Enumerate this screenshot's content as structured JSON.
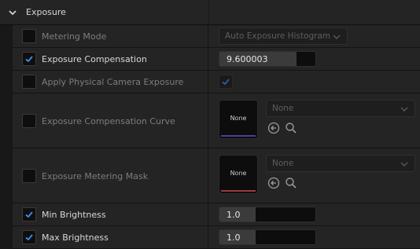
{
  "section": {
    "title": "Exposure",
    "icon": "chevron-down-icon"
  },
  "rows": [
    {
      "label": "Metering Mode",
      "checked": false,
      "enabled": false,
      "value": "Auto Exposure Histogram"
    },
    {
      "label": "Exposure Compensation",
      "checked": true,
      "enabled": true,
      "value": "9.600003",
      "fill_fraction": 0.8
    },
    {
      "label": "Apply Physical Camera Exposure",
      "checked": false,
      "enabled": false,
      "value_checked": true
    },
    {
      "label": "Exposure Compensation Curve",
      "checked": false,
      "enabled": false,
      "thumb": "None",
      "asset": "None",
      "thumb_color": "#4a3f9e"
    },
    {
      "label": "Exposure Metering Mask",
      "checked": false,
      "enabled": false,
      "thumb": "None",
      "asset": "None",
      "thumb_color": "#9e3a3f"
    },
    {
      "label": "Min Brightness",
      "checked": true,
      "enabled": true,
      "value": "1.0",
      "fill_fraction": 0.38
    },
    {
      "label": "Max Brightness",
      "checked": true,
      "enabled": true,
      "value": "1.0",
      "fill_fraction": 0.38
    }
  ],
  "colors": {
    "accent": "#3e8ef0",
    "bg": "#242424"
  }
}
